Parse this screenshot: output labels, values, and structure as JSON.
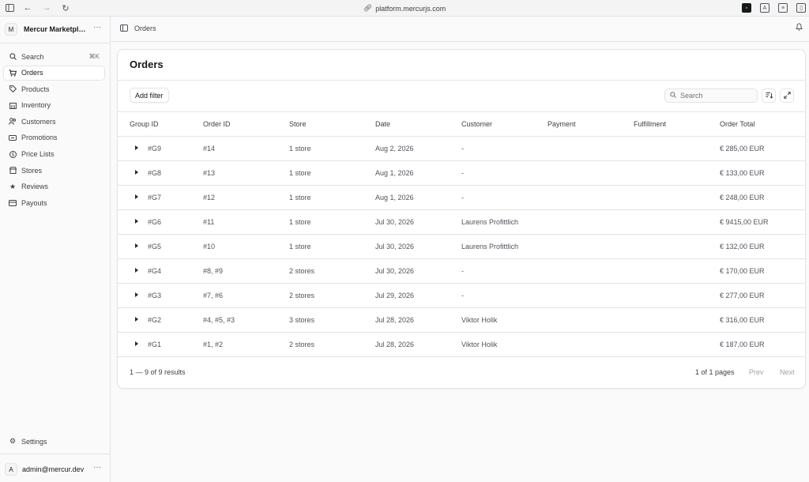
{
  "browser": {
    "url": "platform.mercurjs.com"
  },
  "sidebar": {
    "store_initial": "M",
    "store_name": "Mercur Marketplace",
    "more": "···",
    "items": [
      {
        "label": "Search",
        "icon": "search-icon",
        "shortcut": "⌘K"
      },
      {
        "label": "Orders",
        "icon": "cart-icon",
        "active": true
      },
      {
        "label": "Products",
        "icon": "tag-icon"
      },
      {
        "label": "Inventory",
        "icon": "building-icon"
      },
      {
        "label": "Customers",
        "icon": "users-icon"
      },
      {
        "label": "Promotions",
        "icon": "receipt-icon"
      },
      {
        "label": "Price Lists",
        "icon": "dollar-icon"
      },
      {
        "label": "Stores",
        "icon": "store-icon"
      },
      {
        "label": "Reviews",
        "icon": "star-icon"
      },
      {
        "label": "Payouts",
        "icon": "card-icon"
      }
    ],
    "settings_label": "Settings",
    "user_initial": "A",
    "user_email": "admin@mercur.dev"
  },
  "header": {
    "breadcrumb": "Orders"
  },
  "orders": {
    "title": "Orders",
    "add_filter": "Add filter",
    "search_placeholder": "Search",
    "columns": [
      "Group ID",
      "Order ID",
      "Store",
      "Date",
      "Customer",
      "Payment",
      "Fulfillment",
      "Order Total"
    ],
    "rows": [
      {
        "group": "#G9",
        "order": "#14",
        "store": "1 store",
        "date": "Aug 2, 2026",
        "customer": "-",
        "payment": "",
        "fulfillment": "",
        "total": "€ 285,00 EUR"
      },
      {
        "group": "#G8",
        "order": "#13",
        "store": "1 store",
        "date": "Aug 1, 2026",
        "customer": "-",
        "payment": "",
        "fulfillment": "",
        "total": "€ 133,00 EUR"
      },
      {
        "group": "#G7",
        "order": "#12",
        "store": "1 store",
        "date": "Aug 1, 2026",
        "customer": "-",
        "payment": "",
        "fulfillment": "",
        "total": "€ 248,00 EUR"
      },
      {
        "group": "#G6",
        "order": "#11",
        "store": "1 store",
        "date": "Jul 30, 2026",
        "customer": "Laurens Profittlich",
        "payment": "",
        "fulfillment": "",
        "total": "€ 9415,00 EUR"
      },
      {
        "group": "#G5",
        "order": "#10",
        "store": "1 store",
        "date": "Jul 30, 2026",
        "customer": "Laurens Profittlich",
        "payment": "",
        "fulfillment": "",
        "total": "€ 132,00 EUR"
      },
      {
        "group": "#G4",
        "order": "#8, #9",
        "store": "2 stores",
        "date": "Jul 30, 2026",
        "customer": "-",
        "payment": "",
        "fulfillment": "",
        "total": "€ 170,00 EUR"
      },
      {
        "group": "#G3",
        "order": "#7, #6",
        "store": "2 stores",
        "date": "Jul 29, 2026",
        "customer": "-",
        "payment": "",
        "fulfillment": "",
        "total": "€ 277,00 EUR"
      },
      {
        "group": "#G2",
        "order": "#4, #5, #3",
        "store": "3 stores",
        "date": "Jul 28, 2026",
        "customer": "Viktor Holik",
        "payment": "",
        "fulfillment": "",
        "total": "€ 316,00 EUR"
      },
      {
        "group": "#G1",
        "order": "#1, #2",
        "store": "2 stores",
        "date": "Jul 28, 2026",
        "customer": "Viktor Holik",
        "payment": "",
        "fulfillment": "",
        "total": "€ 187,00 EUR"
      }
    ],
    "results_text": "1 — 9 of 9 results",
    "pages_text": "1 of 1 pages",
    "prev": "Prev",
    "next": "Next"
  }
}
